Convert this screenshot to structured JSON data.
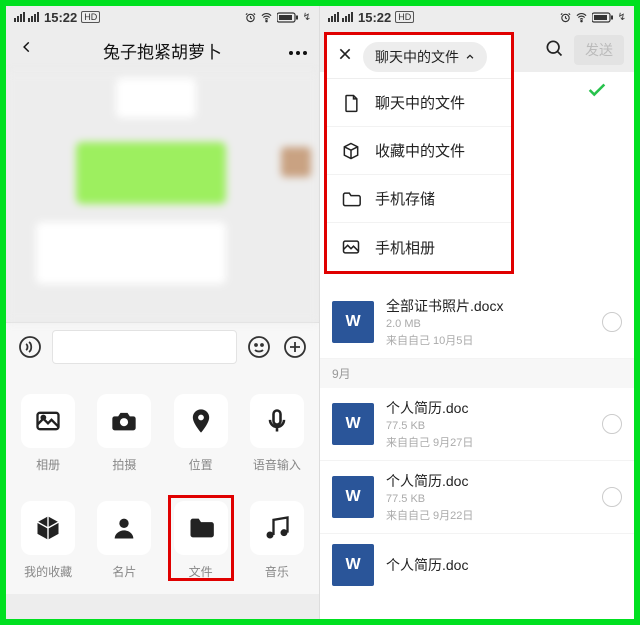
{
  "status": {
    "time": "15:22"
  },
  "left": {
    "chat_title": "兔子抱紧胡萝卜",
    "grid": [
      {
        "label": "相册"
      },
      {
        "label": "拍摄"
      },
      {
        "label": "位置"
      },
      {
        "label": "语音输入"
      },
      {
        "label": "我的收藏"
      },
      {
        "label": "名片"
      },
      {
        "label": "文件"
      },
      {
        "label": "音乐"
      }
    ]
  },
  "right": {
    "filter_pill": "聊天中的文件",
    "send_label": "发送",
    "dropdown": [
      "聊天中的文件",
      "收藏中的文件",
      "手机存储",
      "手机相册"
    ],
    "section_sep": "9月",
    "files": [
      {
        "name": "全部证书照片.docx",
        "size": "2.0 MB",
        "from": "来自自己  10月5日",
        "w": "W"
      },
      {
        "name": "个人简历.doc",
        "size": "77.5 KB",
        "from": "来自自己  9月27日",
        "w": "W"
      },
      {
        "name": "个人简历.doc",
        "size": "77.5 KB",
        "from": "来自自己  9月22日",
        "w": "W"
      },
      {
        "name": "个人简历.doc",
        "size": "",
        "from": "",
        "w": "W"
      }
    ]
  }
}
